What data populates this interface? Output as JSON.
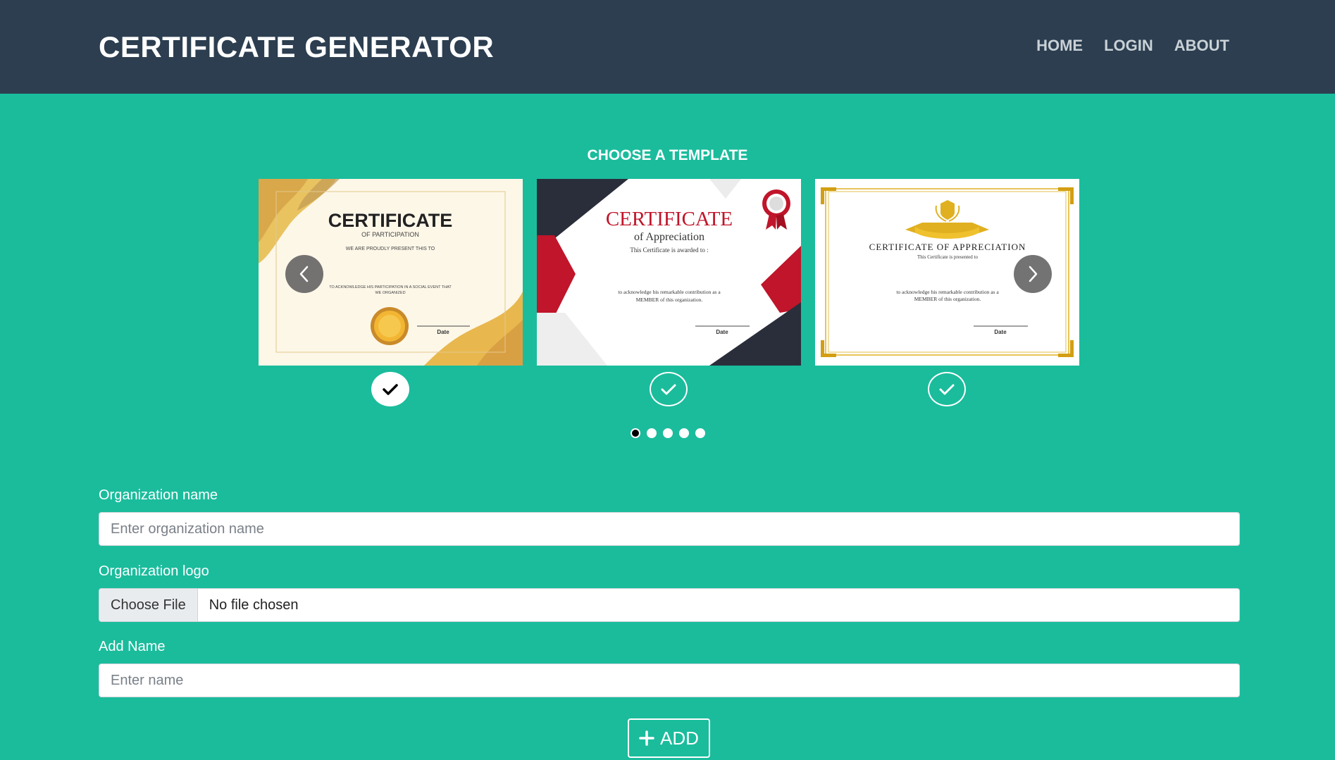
{
  "header": {
    "brand": "CERTIFICATE GENERATOR",
    "nav": [
      "HOME",
      "LOGIN",
      "ABOUT"
    ]
  },
  "templates_section": {
    "title": "CHOOSE A TEMPLATE",
    "active_dot": 1,
    "dot_count": 5,
    "templates": [
      {
        "title": "CERTIFICATE",
        "subtitle": "OF PARTICIPATION",
        "line1": "WE ARE PROUDLY PRESENT THIS TO",
        "body1": "TO ACKNOWLEDGE HIS PARTICIPATION IN A SOCIAL EVENT THAT",
        "body2": "WE ORGANIZED",
        "date": "Date",
        "selected": true
      },
      {
        "title": "CERTIFICATE",
        "subtitle": "of Appreciation",
        "line1": "This Certificate is awarded to :",
        "body1": "to acknowledge his remarkable contribution as a",
        "body2": "MEMBER of this organization.",
        "date": "Date",
        "selected": false
      },
      {
        "title": "CERTIFICATE OF APPRECIATION",
        "line1": "This Certificate is presented to",
        "body1": "to acknowledge his remarkable contribution as a",
        "body2": "MEMBER of this organization.",
        "date": "Date",
        "selected": false
      }
    ]
  },
  "form": {
    "org_name_label": "Organization name",
    "org_name_placeholder": "Enter organization name",
    "org_logo_label": "Organization logo",
    "file_button": "Choose File",
    "file_status": "No file chosen",
    "add_name_label": "Add Name",
    "add_name_placeholder": "Enter name",
    "add_button": "ADD"
  },
  "colors": {
    "background": "#1abc9c",
    "navbar": "#2c3e50",
    "accent_red": "#c0152a",
    "gold": "#e0b020"
  }
}
